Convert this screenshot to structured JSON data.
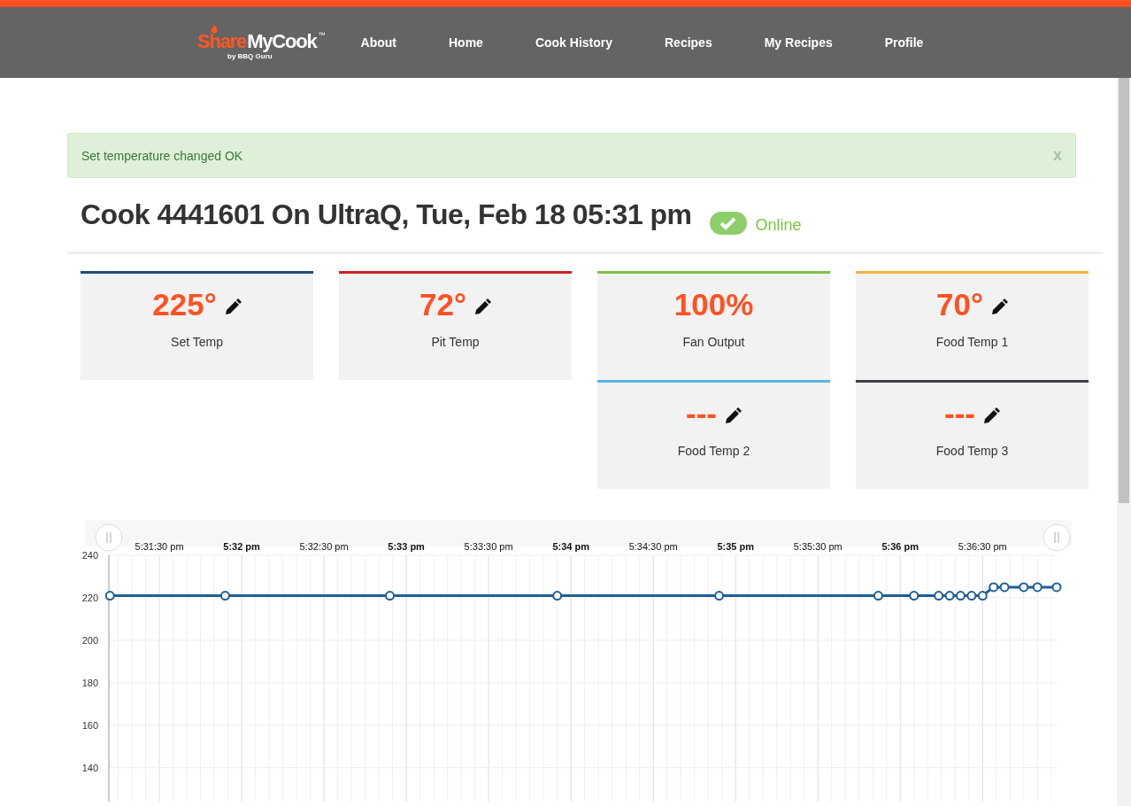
{
  "logo": {
    "part1": "Share",
    "part2": "MyCook",
    "tm": "™",
    "tagline": "by BBQ Guru"
  },
  "nav": [
    "About",
    "Home",
    "Cook History",
    "Recipes",
    "My Recipes",
    "Profile"
  ],
  "alert": {
    "message": "Set temperature changed OK",
    "close": "x"
  },
  "title": "Cook 4441601 On UltraQ, Tue, Feb 18 05:31 pm",
  "status": {
    "label": "Online",
    "online": true
  },
  "columns": [
    [
      {
        "value": "225°",
        "label": "Set Temp",
        "color": "#1f4e79",
        "editable": true
      }
    ],
    [
      {
        "value": "72°",
        "label": "Pit Temp",
        "color": "#cc2222",
        "editable": true
      }
    ],
    [
      {
        "value": "100%",
        "label": "Fan Output",
        "color": "#7cc444",
        "editable": false
      },
      {
        "value": "---",
        "label": "Food Temp 2",
        "color": "#5ab4e6",
        "editable": true
      }
    ],
    [
      {
        "value": "70°",
        "label": "Food Temp 1",
        "color": "#f0b542",
        "editable": true
      },
      {
        "value": "---",
        "label": "Food Temp 3",
        "color": "#404048",
        "editable": true
      }
    ]
  ],
  "chart_data": {
    "type": "line",
    "x": [
      63072,
      63114,
      63174,
      63235,
      63294,
      63352,
      63365,
      63374,
      63378,
      63382,
      63386,
      63390,
      63394,
      63398,
      63405,
      63410,
      63417
    ],
    "grid": true,
    "series": [
      {
        "color": "#1f5f96",
        "marker": "circle",
        "values": [
          221,
          221,
          221,
          221,
          221,
          221,
          221,
          221,
          221,
          221,
          221,
          221,
          225,
          225,
          225,
          225,
          225
        ]
      }
    ],
    "xlim": [
      63071.6,
      63417
    ],
    "ylim": [
      124,
      240
    ],
    "xticks": [
      {
        "value": 63090,
        "label": "5:31:30 pm"
      },
      {
        "value": 63120,
        "label": "5:32 pm"
      },
      {
        "value": 63150,
        "label": "5:32:30 pm"
      },
      {
        "value": 63180,
        "label": "5:33 pm"
      },
      {
        "value": 63210,
        "label": "5:33:30 pm"
      },
      {
        "value": 63240,
        "label": "5:34 pm"
      },
      {
        "value": 63270,
        "label": "5:34:30 pm"
      },
      {
        "value": 63300,
        "label": "5:35 pm"
      },
      {
        "value": 63330,
        "label": "5:35:30 pm"
      },
      {
        "value": 63360,
        "label": "5:36 pm"
      },
      {
        "value": 63390,
        "label": "5:36:30 pm"
      }
    ],
    "yticks": [
      140,
      160,
      180,
      200,
      220,
      240
    ]
  }
}
